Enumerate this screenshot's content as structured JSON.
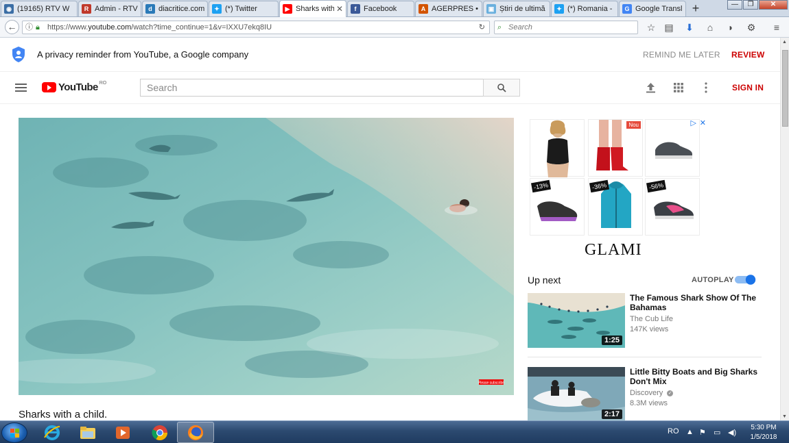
{
  "browser": {
    "tabs": [
      {
        "label": "(19165) RTV W",
        "icon": "globe-icon",
        "color": "#3b6ea5"
      },
      {
        "label": "Admin - RTV",
        "icon": "r-icon",
        "color": "#c0392b"
      },
      {
        "label": "diacritice.com",
        "icon": "d-icon",
        "color": "#2a7ab8"
      },
      {
        "label": "(*) Twitter",
        "icon": "twitter-icon",
        "color": "#1da1f2"
      },
      {
        "label": "Sharks with",
        "icon": "youtube-icon",
        "color": "#ff0000",
        "active": true
      },
      {
        "label": "Facebook",
        "icon": "facebook-icon",
        "color": "#3b5998"
      },
      {
        "label": "AGERPRES • A",
        "icon": "agerpres-icon",
        "color": "#d35400"
      },
      {
        "label": "Știri de ultimă",
        "icon": "news-icon",
        "color": "#6ab0de"
      },
      {
        "label": "(*) Romania -",
        "icon": "twitter-icon",
        "color": "#1da1f2"
      },
      {
        "label": "Google Transl",
        "icon": "google-translate-icon",
        "color": "#4285f4"
      }
    ],
    "url_prefix": "https://www.",
    "url_host": "youtube.com",
    "url_path": "/watch?time_continue=1&v=IXXU7ekq8IU",
    "search_placeholder": "Search"
  },
  "privacy": {
    "text": "A privacy reminder from YouTube, a Google company",
    "remind_label": "REMIND ME LATER",
    "review_label": "REVIEW"
  },
  "header": {
    "logo_text": "YouTube",
    "country": "RO",
    "search_placeholder": "Search",
    "signin_label": "SIGN IN"
  },
  "video": {
    "title": "Sharks with a child.",
    "watermark": "Please subscribe"
  },
  "ad": {
    "brand": "GLAMI",
    "products": [
      {
        "name": "swimsuit",
        "badge": ""
      },
      {
        "name": "red-boots",
        "badge": "Nou"
      },
      {
        "name": "grey-sneakers",
        "badge": ""
      },
      {
        "name": "purple-sneakers",
        "badge": "-13%"
      },
      {
        "name": "teal-jacket",
        "badge": "-36%"
      },
      {
        "name": "pink-sneakers",
        "badge": "-56%"
      }
    ]
  },
  "upnext": {
    "label": "Up next",
    "autoplay_label": "AUTOPLAY",
    "autoplay_on": true,
    "items": [
      {
        "title": "The Famous Shark Show Of The Bahamas",
        "channel": "The Cub Life",
        "views": "147K views",
        "duration": "1:25",
        "verified": false
      },
      {
        "title": "Little Bitty Boats and Big Sharks Don't Mix",
        "channel": "Discovery",
        "views": "8.3M views",
        "duration": "2:17",
        "verified": true
      }
    ]
  },
  "taskbar": {
    "language": "RO",
    "time": "5:30 PM",
    "date": "1/5/2018"
  }
}
